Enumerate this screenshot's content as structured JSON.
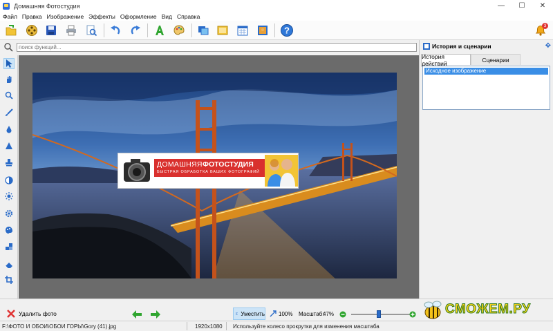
{
  "window": {
    "title": "Домашняя Фотостудия",
    "minimize": "—",
    "maximize": "☐",
    "close": "✕"
  },
  "menu": [
    "Файл",
    "Правка",
    "Изображение",
    "Эффекты",
    "Оформление",
    "Вид",
    "Справка"
  ],
  "toolbar": {
    "icons": [
      "open-file-icon",
      "film-reel-icon",
      "save-icon",
      "print-icon",
      "preview-icon",
      "undo-icon",
      "redo-icon",
      "text-icon",
      "palette-icon",
      "frames-icon",
      "postcard-icon",
      "calendar-icon",
      "collage-icon",
      "help-icon",
      "notifications-bell-icon"
    ],
    "notification_count": "3"
  },
  "search": {
    "placeholder": "поиск функций..."
  },
  "right_panel": {
    "title": "История и сценарии",
    "tabs": [
      "История действий",
      "Сценарии"
    ],
    "history_items": [
      "Исходное изображение"
    ]
  },
  "banner": {
    "title_light": "ДОМАШНЯЯ",
    "title_bold": "ФОТОСТУДИЯ",
    "subtitle": "БЫСТРАЯ ОБРАБОТКА ВАШИХ ФОТОГРАФИЙ"
  },
  "bottom": {
    "delete_label": "Удалить фото",
    "fit_label": "Уместить",
    "zoom100_label": "100%",
    "scale_label": "Масштаб:",
    "scale_value": "47%",
    "zoom_fraction": 0.47
  },
  "watermark": "СМОЖЕМ.РУ",
  "status": {
    "path": "F:\\ФОТО И ОБОИ\\ОБОИ ГОРЫ\\Gory (41).jpg",
    "dimensions": "1920x1080",
    "hint": "Используйте колесо прокрутки для изменения масштаба"
  },
  "colors": {
    "accent": "#3a8ee6",
    "banner_red": "#d9302e",
    "toolbar_green": "#2fa52f"
  }
}
